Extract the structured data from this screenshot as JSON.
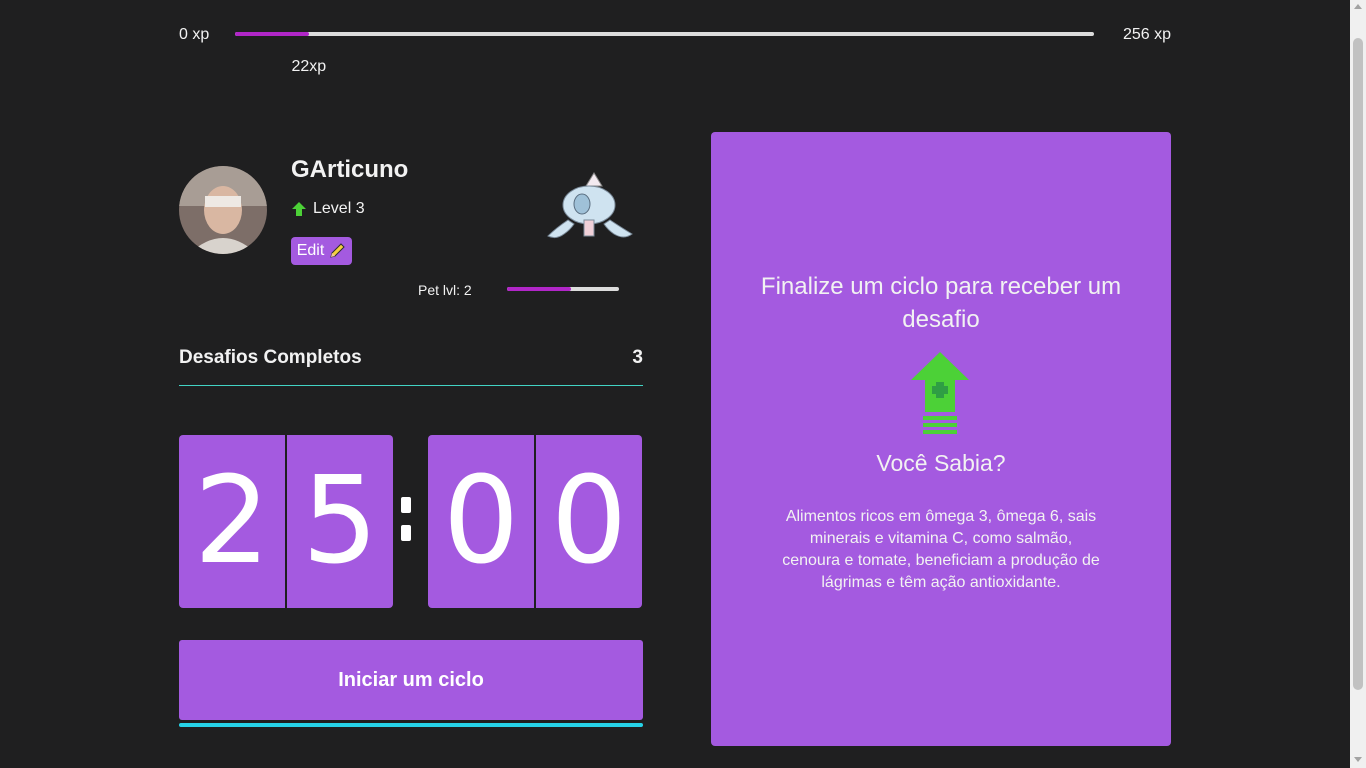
{
  "xp": {
    "min_label": "0 xp",
    "max_label": "256 xp",
    "current_label": "22xp",
    "current": 22,
    "max": 256,
    "fill_color": "#b126c8"
  },
  "profile": {
    "name": "GArticuno",
    "level_label": "Level 3",
    "edit_label": "Edit",
    "avatar_icon": "user-photo"
  },
  "pet": {
    "level_label": "Pet lvl: 2",
    "progress": 0.57,
    "icon": "pet-sprite"
  },
  "challenges": {
    "label": "Desafios Completos",
    "count": "3"
  },
  "countdown": {
    "minute_tens": "2",
    "minute_ones": "5",
    "second_tens": "0",
    "second_ones": "0"
  },
  "actions": {
    "start_label": "Iniciar um ciclo"
  },
  "challenge_card": {
    "title": "Finalize um ciclo para receber um desafio",
    "icon": "level-up-arrow-icon",
    "subtitle": "Você Sabia?",
    "text": "Alimentos ricos em ômega 3, ômega 6, sais minerais e vitamina C, como salmão, cenoura e tomate, beneficiam a produção de lágrimas e têm ação antioxidante."
  },
  "colors": {
    "accent": "#a45ae0",
    "background": "#1f1f20",
    "divider": "#42d3c4",
    "start_underline": "#26d3e8",
    "level_green": "#4cd137"
  }
}
